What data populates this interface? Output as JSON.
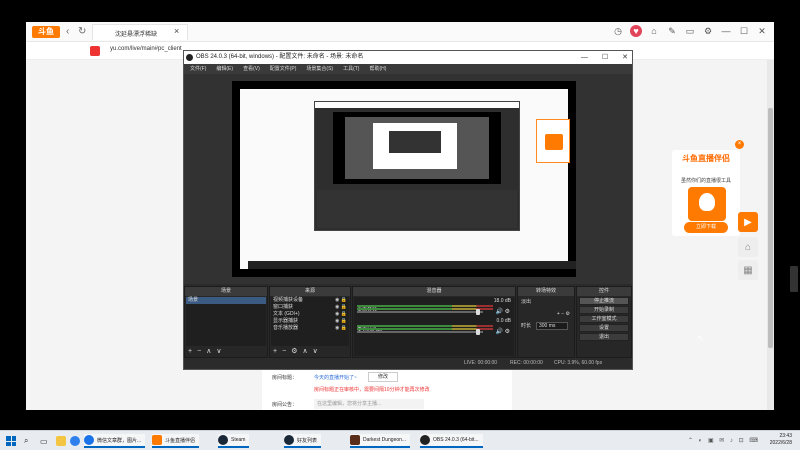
{
  "browser": {
    "logo": "斗鱼",
    "tab_title": "沈延悬漂浮稀缺",
    "url": "yu.com/live/main#pc_client",
    "nav": {
      "back": "‹",
      "forward": "↻"
    },
    "top_icons": [
      "clock-icon",
      "heart-icon",
      "shirt-icon",
      "pen-icon",
      "window-icon",
      "settings-icon",
      "minimize-icon",
      "maximize-icon",
      "close-icon"
    ]
  },
  "page": {
    "room_title_label": "房间标题：",
    "room_title_link": "今天的直播开始了~",
    "edit_button": "修改",
    "warning": "房间标题正在审核中，需要间隔10分钟才能再次修改",
    "announcement_label": "房间公告：",
    "announcement_placeholder": "在这里编辑，您将分享主播..."
  },
  "ad": {
    "title": "斗鱼直播伴侣",
    "subtitle": "虽然你们的直播很工具",
    "button": "立即下载",
    "close": "×"
  },
  "obs": {
    "title": "OBS 24.0.3 (64-bit, windows) - 配置文件: 未命名 - 场景: 未命名",
    "window_controls": [
      "—",
      "☐",
      "✕"
    ],
    "menu": [
      "文件(F)",
      "编辑(E)",
      "查看(V)",
      "配置文件(P)",
      "场景集合(S)",
      "工具(T)",
      "帮助(H)"
    ],
    "docks": {
      "scenes": {
        "header": "场景",
        "items": [
          "场景"
        ]
      },
      "sources": {
        "header": "来源",
        "items": [
          "视频捕获设备",
          "窗口捕获",
          "文本 (GDI+)",
          "显示器捕获",
          "音乐播放器"
        ]
      },
      "mixer": {
        "header": "混音器",
        "channels": [
          {
            "name": "桌面音频",
            "db": "18.0 dB"
          },
          {
            "name": "麦克风/Aux",
            "db": "0.0 dB"
          }
        ]
      },
      "transitions": {
        "header": "转场特效",
        "type": "淡出",
        "duration_label": "时长",
        "duration_value": "300 ms"
      },
      "controls": {
        "header": "控件",
        "buttons": [
          "停止推流",
          "开始录制",
          "工作室模式",
          "设置",
          "退出"
        ]
      }
    },
    "status": {
      "live": "LIVE: 00:00:00",
      "rec": "REC: 00:00:00",
      "cpu": "CPU: 3.9%, 60.00 fps"
    }
  },
  "taskbar": {
    "apps": [
      {
        "label": "微信文章群，图片...",
        "icon_color": "#1a73e8"
      },
      {
        "label": "斗鱼直播伴侣",
        "icon_color": "#ff7a00"
      },
      {
        "label": "Steam",
        "icon_color": "#1b2838"
      },
      {
        "label": "好友列表",
        "icon_color": "#1b2838"
      },
      {
        "label": "Darkest Dungeon...",
        "icon_color": "#5a2d1a"
      },
      {
        "label": "OBS 24.0.3 (64-bit...",
        "icon_color": "#222222"
      }
    ],
    "time": "23:43",
    "date": "2022/6/28"
  },
  "colors": {
    "accent": "#ff7a00",
    "obs_bg": "#2b2b2b",
    "link": "#2a6cd8",
    "warning": "#e33333"
  }
}
